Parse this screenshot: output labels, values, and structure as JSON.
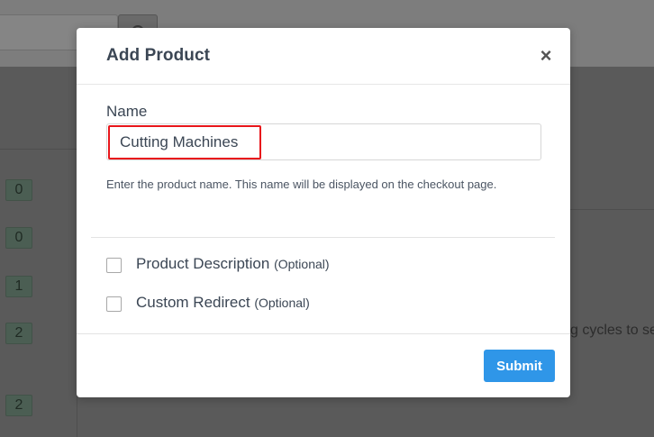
{
  "background": {
    "badges": [
      "0",
      "0",
      "1",
      "2",
      "2"
    ],
    "partial_text": "g cycles to se"
  },
  "modal": {
    "title": "Add Product",
    "close_glyph": "×",
    "name_label": "Name",
    "name_value": "Cutting Machines",
    "help_text": "Enter the product name. This name will be displayed on the checkout page.",
    "options": [
      {
        "label": "Product Description",
        "optional": "(Optional)",
        "checked": false
      },
      {
        "label": "Custom Redirect",
        "optional": "(Optional)",
        "checked": false
      }
    ],
    "submit_label": "Submit"
  },
  "colors": {
    "accent": "#2f96e8",
    "highlight": "#e8161b"
  }
}
